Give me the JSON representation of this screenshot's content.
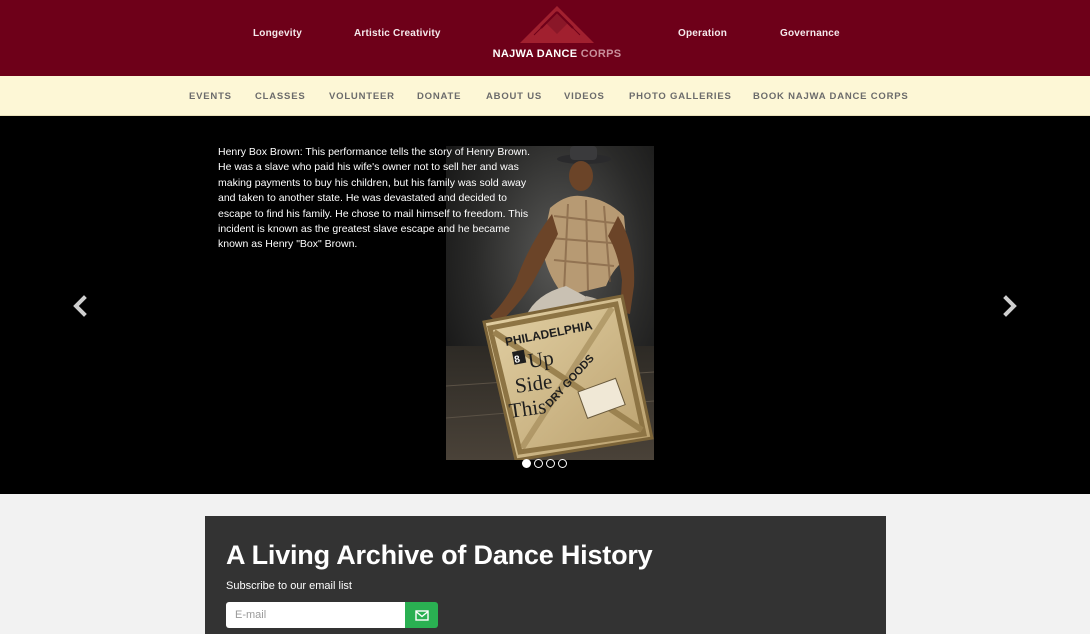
{
  "header": {
    "nav_left": [
      "Longevity",
      "Artistic Creativity"
    ],
    "nav_right": [
      "Operation",
      "Governance"
    ],
    "logo": {
      "word1": "NAJWA DANCE",
      "word2": "CORPS",
      "mark_color": "#a1202f"
    },
    "background": "#6e0019"
  },
  "subnav": {
    "items": [
      "EVENTS",
      "CLASSES",
      "VOLUNTEER",
      "DONATE",
      "ABOUT US",
      "VIDEOS",
      "PHOTO GALLERIES",
      "BOOK NAJWA DANCE CORPS"
    ],
    "background": "#fdf7d6"
  },
  "carousel": {
    "caption": "Henry Box Brown: This performance tells the story of Henry Brown. He was a slave who paid his wife's owner not to sell her and was making payments to buy his children, but his family was sold away and taken to another state. He was devastated and decided to escape to find his family. He chose to mail himself to freedom. This incident is known as the greatest slave escape and he became known as Henry \"Box\" Brown.",
    "prev_icon": "chevron-left-icon",
    "next_icon": "chevron-right-icon",
    "slide_count": 4,
    "active_slide": 1,
    "crate_text": {
      "stencil": "PHILADELPHIA",
      "number": "8",
      "line1": "Up",
      "line2": "Side",
      "line3": "This",
      "goods": "DRY GOODS"
    }
  },
  "archive": {
    "title": "A Living Archive of Dance History",
    "subtitle": "Subscribe to our email list",
    "email_placeholder": "E-mail",
    "submit_icon": "envelope-icon",
    "button_color": "#2ab052"
  }
}
